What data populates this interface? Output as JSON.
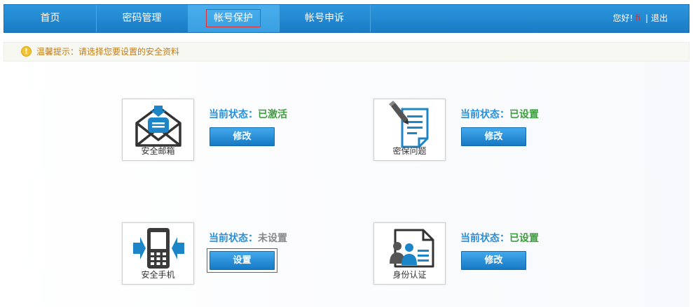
{
  "nav": {
    "tabs": [
      {
        "label": "首页"
      },
      {
        "label": "密码管理"
      },
      {
        "label": "帐号保护"
      },
      {
        "label": "帐号申诉"
      }
    ],
    "greeting": "您好!",
    "username": "fi",
    "separator": "|",
    "logout": "退出"
  },
  "tip": {
    "icon": "warning-icon",
    "text": "温馨提示：请选择您要设置的安全资料"
  },
  "colors": {
    "nav_bg": "#1f86cf",
    "status_key": "#2a8fd6",
    "status_ok": "#3e9e3e",
    "status_unset": "#888888",
    "highlight": "#e03030"
  },
  "cards": [
    {
      "caption": "安全邮箱",
      "status_key": "当前状态：",
      "status_value": "已激活",
      "button": "修改",
      "icon": "envelope-icon"
    },
    {
      "caption": "密保问题",
      "status_key": "当前状态：",
      "status_value": "已设置",
      "button": "修改",
      "icon": "document-pen-icon"
    },
    {
      "caption": "安全手机",
      "status_key": "当前状态：",
      "status_value": "未设置",
      "button": "设置",
      "icon": "mobile-phone-icon"
    },
    {
      "caption": "身份认证",
      "status_key": "当前状态：",
      "status_value": "已设置",
      "button": "修改",
      "icon": "id-card-icon"
    }
  ]
}
